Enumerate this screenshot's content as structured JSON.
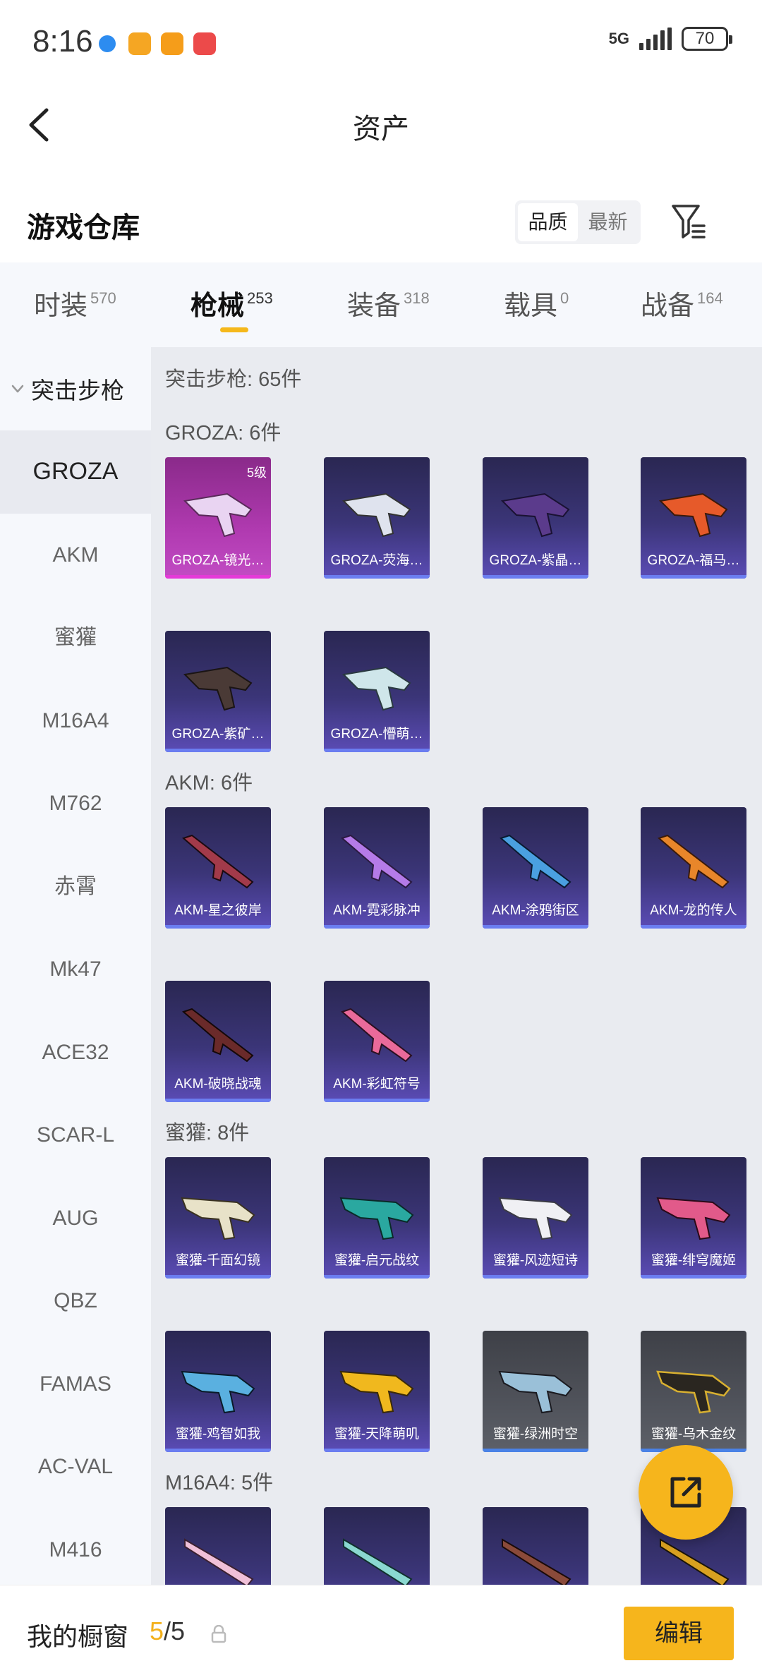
{
  "status": {
    "time": "8:16",
    "network": "5G",
    "battery": "70"
  },
  "header": {
    "back_icon": "chevron-left-icon",
    "title": "资产"
  },
  "section": {
    "title": "游戏仓库",
    "sort_options": [
      "品质",
      "最新"
    ],
    "active_sort": "品质",
    "filter_icon": "filter-icon"
  },
  "tabs": [
    {
      "label": "时装",
      "count": "570"
    },
    {
      "label": "枪械",
      "count": "253"
    },
    {
      "label": "装备",
      "count": "318"
    },
    {
      "label": "载具",
      "count": "0"
    },
    {
      "label": "战备",
      "count": "164"
    }
  ],
  "active_tab": "枪械",
  "sidebar": {
    "group": "突击步枪",
    "items": [
      "GROZA",
      "AKM",
      "蜜獾",
      "M16A4",
      "M762",
      "赤霄",
      "Mk47",
      "ACE32",
      "SCAR-L",
      "AUG",
      "QBZ",
      "FAMAS",
      "AC-VAL",
      "M416"
    ],
    "active_item": "GROZA"
  },
  "main": {
    "category_summary": "突击步枪: 65件",
    "groups": [
      {
        "label": "GROZA: 6件",
        "items": [
          {
            "name": "GROZA-镜光…",
            "level": "5级"
          },
          {
            "name": "GROZA-荧海…"
          },
          {
            "name": "GROZA-紫晶…"
          },
          {
            "name": "GROZA-福马…"
          },
          {
            "name": "GROZA-紫矿…"
          },
          {
            "name": "GROZA-懵萌…"
          }
        ]
      },
      {
        "label": "AKM: 6件",
        "items": [
          {
            "name": "AKM-星之彼岸"
          },
          {
            "name": "AKM-霓彩脉冲"
          },
          {
            "name": "AKM-涂鸦街区"
          },
          {
            "name": "AKM-龙的传人"
          },
          {
            "name": "AKM-破晓战魂"
          },
          {
            "name": "AKM-彩虹符号"
          }
        ]
      },
      {
        "label": "蜜獾: 8件",
        "items": [
          {
            "name": "蜜獾-千面幻镜"
          },
          {
            "name": "蜜獾-启元战纹"
          },
          {
            "name": "蜜獾-风迹短诗"
          },
          {
            "name": "蜜獾-绯穹魔姬"
          },
          {
            "name": "蜜獾-鸡智如我"
          },
          {
            "name": "蜜獾-天降萌叽"
          },
          {
            "name": "蜜獾-绿洲时空"
          },
          {
            "name": "蜜獾-乌木金纹"
          }
        ]
      },
      {
        "label": "M16A4: 5件",
        "items": []
      }
    ]
  },
  "fab": {
    "icon": "share-external-icon"
  },
  "bottom": {
    "label": "我的橱窗",
    "current": "5",
    "total": "/5",
    "lock_icon": "lock-icon",
    "edit_label": "编辑"
  },
  "colors": {
    "accent": "#f6b51c",
    "card_bg": "#3b3578",
    "card_gold": "#b03ab0",
    "card_grey": "#53565e"
  }
}
